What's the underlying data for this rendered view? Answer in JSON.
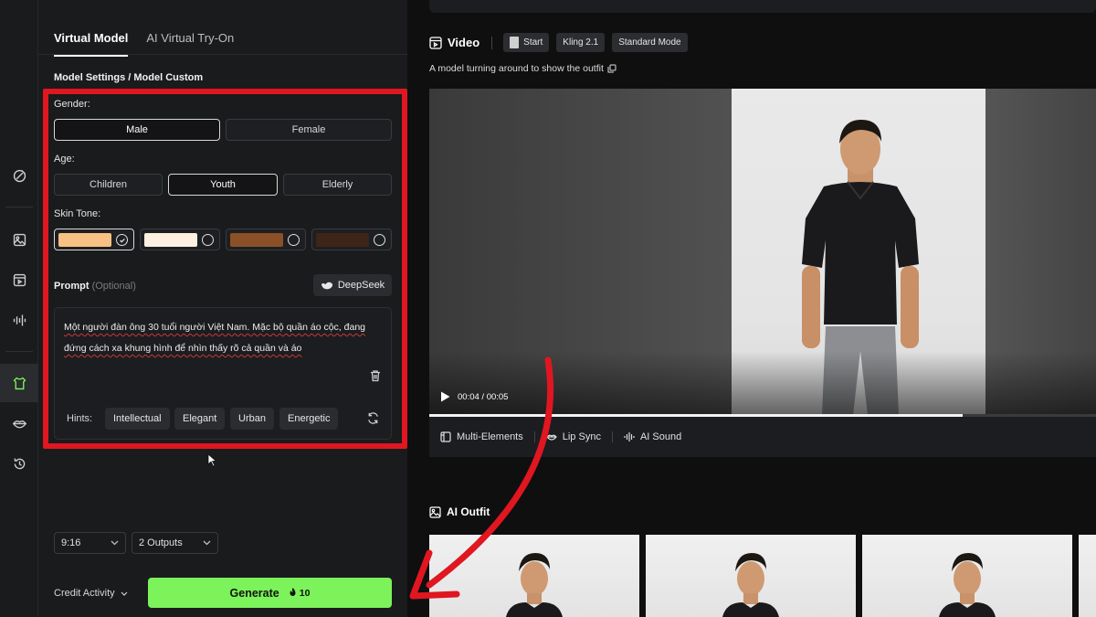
{
  "panel": {
    "tabs": [
      {
        "label": "Virtual Model",
        "active": true
      },
      {
        "label": "AI Virtual Try-On",
        "active": false
      }
    ],
    "section_title": "Model Settings / Model Custom",
    "gender": {
      "label": "Gender:",
      "options": [
        "Male",
        "Female"
      ],
      "selected": "Male"
    },
    "age": {
      "label": "Age:",
      "options": [
        "Children",
        "Youth",
        "Elderly"
      ],
      "selected": "Youth"
    },
    "skin_tone": {
      "label": "Skin Tone:",
      "swatches": [
        "#f7c184",
        "#fdf0e1",
        "#8b5027",
        "#3d2518"
      ],
      "selected_index": 0
    },
    "prompt": {
      "label": "Prompt",
      "optional": "(Optional)",
      "deepseek": "DeepSeek",
      "text": "Một người đàn ông 30 tuổi người Việt Nam. Mặc bộ quần áo cộc, đang đứng cách xa khung hình để nhìn thấy rõ cả quần và áo",
      "hints_label": "Hints:",
      "hints": [
        "Intellectual",
        "Elegant",
        "Urban",
        "Energetic"
      ]
    },
    "aspect_ratio": "9:16",
    "outputs": "2 Outputs",
    "credit_activity": "Credit Activity",
    "generate": {
      "label": "Generate",
      "cost": "10"
    }
  },
  "video": {
    "title": "Video",
    "chips": [
      "Start",
      "Kling 2.1",
      "Standard Mode"
    ],
    "description": "A model turning around to show the outfit",
    "time": "00:04 / 00:05",
    "progress": 0.8,
    "features": [
      "Multi-Elements",
      "Lip Sync",
      "AI Sound"
    ]
  },
  "outfit": {
    "title": "AI Outfit"
  },
  "colors": {
    "accent_green": "#7cf25b",
    "highlight_red": "#e01620",
    "panel_bg": "#1a1b1d"
  }
}
